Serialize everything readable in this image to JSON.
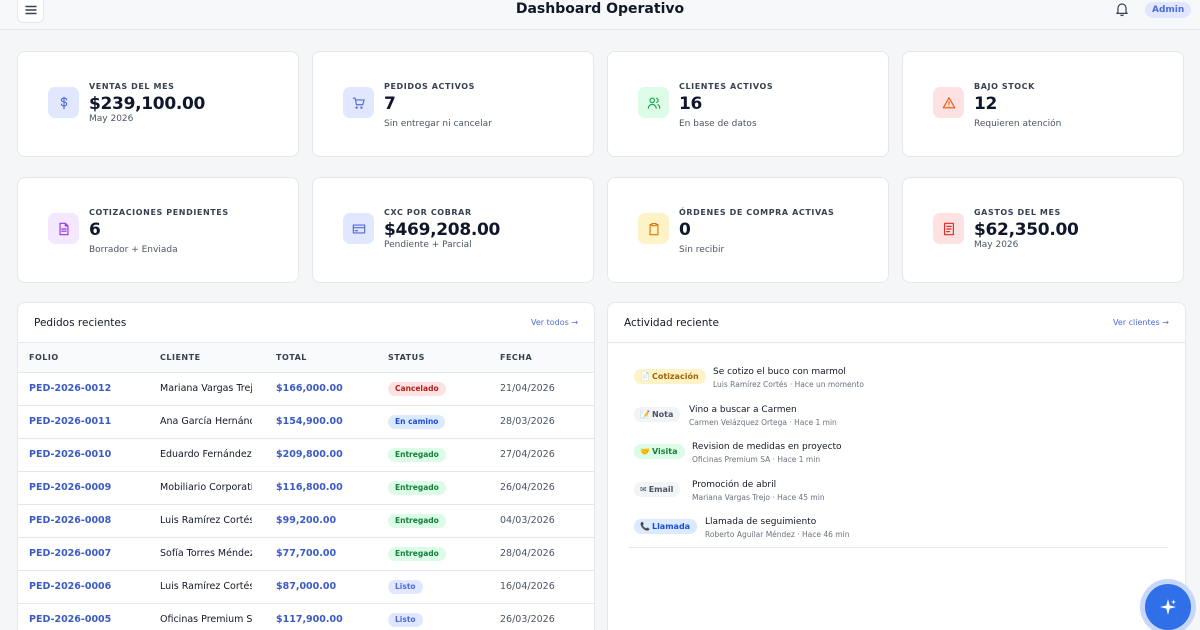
{
  "header": {
    "title": "Dashboard Operativo",
    "role_badge": "Admin",
    "menu_icon": "hamburger-icon",
    "bell_icon": "bell-icon"
  },
  "stats": [
    {
      "label": "VENTAS DEL MES",
      "value": "$239,100.00",
      "sub": "May 2026",
      "icon": "dollar-icon",
      "accent": "#e0e7ff",
      "icon_color": "#4f6bd8"
    },
    {
      "label": "PEDIDOS ACTIVOS",
      "value": "7",
      "sub": "Sin entregar ni cancelar",
      "icon": "cart-icon",
      "accent": "#e0e7ff",
      "icon_color": "#4f6bd8"
    },
    {
      "label": "CLIENTES ACTIVOS",
      "value": "16",
      "sub": "En base de datos",
      "icon": "users-icon",
      "accent": "#dcfce7",
      "icon_color": "#16a34a"
    },
    {
      "label": "BAJO STOCK",
      "value": "12",
      "sub": "Requieren atención",
      "icon": "warning-icon",
      "accent": "#fee2e2",
      "icon_color": "#ea580c"
    },
    {
      "label": "COTIZACIONES PENDIENTES",
      "value": "6",
      "sub": "Borrador + Enviada",
      "icon": "document-icon",
      "accent": "#f3e8ff",
      "icon_color": "#9333ea"
    },
    {
      "label": "CXC POR COBRAR",
      "value": "$469,208.00",
      "sub": "Pendiente + Parcial",
      "icon": "credit-card-icon",
      "accent": "#e0e7ff",
      "icon_color": "#4f6bd8"
    },
    {
      "label": "ÓRDENES DE COMPRA ACTIVAS",
      "value": "0",
      "sub": "Sin recibir",
      "icon": "clipboard-icon",
      "accent": "#fef3c7",
      "icon_color": "#d97706"
    },
    {
      "label": "GASTOS DEL MES",
      "value": "$62,350.00",
      "sub": "May 2026",
      "icon": "receipt-icon",
      "accent": "#fee2e2",
      "icon_color": "#dc2626"
    }
  ],
  "orders": {
    "title": "Pedidos recientes",
    "link": "Ver todos →",
    "columns": [
      "FOLIO",
      "CLIENTE",
      "TOTAL",
      "STATUS",
      "FECHA"
    ],
    "rows": [
      {
        "folio": "PED-2026-0012",
        "cliente": "Mariana Vargas Trejo",
        "total": "$166,000.00",
        "status": "Cancelado",
        "fecha": "21/04/2026"
      },
      {
        "folio": "PED-2026-0011",
        "cliente": "Ana García Hernández",
        "total": "$154,900.00",
        "status": "En camino",
        "fecha": "28/03/2026"
      },
      {
        "folio": "PED-2026-0010",
        "cliente": "Eduardo Fernández",
        "total": "$209,800.00",
        "status": "Entregado",
        "fecha": "27/04/2026"
      },
      {
        "folio": "PED-2026-0009",
        "cliente": "Mobiliario Corporativo",
        "total": "$116,800.00",
        "status": "Entregado",
        "fecha": "26/04/2026"
      },
      {
        "folio": "PED-2026-0008",
        "cliente": "Luis Ramírez Cortés",
        "total": "$99,200.00",
        "status": "Entregado",
        "fecha": "04/03/2026"
      },
      {
        "folio": "PED-2026-0007",
        "cliente": "Sofía Torres Méndez",
        "total": "$77,700.00",
        "status": "Entregado",
        "fecha": "28/04/2026"
      },
      {
        "folio": "PED-2026-0006",
        "cliente": "Luis Ramírez Cortés",
        "total": "$87,000.00",
        "status": "Listo",
        "fecha": "16/04/2026"
      },
      {
        "folio": "PED-2026-0005",
        "cliente": "Oficinas Premium SA",
        "total": "$117,900.00",
        "status": "Listo",
        "fecha": "26/03/2026"
      }
    ]
  },
  "activity": {
    "title": "Actividad reciente",
    "link": "Ver clientes →",
    "items": [
      {
        "tag": "Cotización",
        "tag_icon": "📄",
        "type": "cotizacion",
        "text": "Se cotizo el buco con marmol",
        "meta": "Luis Ramírez Cortés · Hace un momento"
      },
      {
        "tag": "Nota",
        "tag_icon": "📝",
        "type": "nota",
        "text": "Vino a buscar a Carmen",
        "meta": "Carmen Velázquez Ortega · Hace 1 min"
      },
      {
        "tag": "Visita",
        "tag_icon": "🤝",
        "type": "visita",
        "text": "Revision de medidas en proyecto",
        "meta": "Oficinas Premium SA · Hace 1 min"
      },
      {
        "tag": "Email",
        "tag_icon": "✉",
        "type": "email",
        "text": "Promoción de abril",
        "meta": "Mariana Vargas Trejo · Hace 45 min"
      },
      {
        "tag": "Llamada",
        "tag_icon": "📞",
        "type": "llamada",
        "text": "Llamada de seguimiento",
        "meta": "Roberto Aguilar Méndez · Hace 46 min"
      }
    ]
  },
  "fab": {
    "icon": "sparkle-icon",
    "color": "#2f6fe8"
  }
}
